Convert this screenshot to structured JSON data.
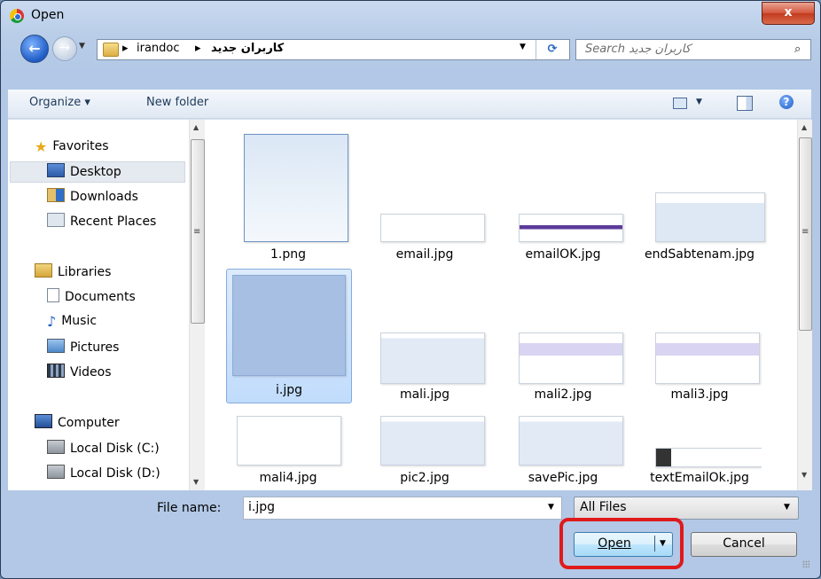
{
  "window": {
    "title": "Open",
    "close_glyph": "x"
  },
  "address": {
    "crumbs": [
      "irandoc",
      "کاربران جدید"
    ],
    "separator": "▸"
  },
  "search": {
    "placeholder": "Search کاربران جدید"
  },
  "toolbar": {
    "organize_label": "Organize ▾",
    "new_folder_label": "New folder"
  },
  "nav": {
    "favorites_label": "Favorites",
    "favorites": [
      "Desktop",
      "Downloads",
      "Recent Places"
    ],
    "selected": "Desktop",
    "libraries_label": "Libraries",
    "libraries": [
      "Documents",
      "Music",
      "Pictures",
      "Videos"
    ],
    "computer_label": "Computer",
    "computer": [
      "Local Disk (C:)",
      "Local Disk (D:)"
    ]
  },
  "files": [
    {
      "name": "1.png"
    },
    {
      "name": "email.jpg"
    },
    {
      "name": "emailOK.jpg"
    },
    {
      "name": "endSabtenam.jpg"
    },
    {
      "name": "i.jpg",
      "selected": true
    },
    {
      "name": "mali.jpg"
    },
    {
      "name": "mali2.jpg"
    },
    {
      "name": "mali3.jpg"
    },
    {
      "name": "mali4.jpg"
    },
    {
      "name": "pic2.jpg"
    },
    {
      "name": "savePic.jpg"
    },
    {
      "name": "textEmailOk.jpg"
    }
  ],
  "bottom": {
    "filename_label": "File name:",
    "filename_value": "i.jpg",
    "filter_value": "All Files",
    "open_label": "Open",
    "cancel_label": "Cancel"
  },
  "colors": {
    "highlight": "#e0191b",
    "selection": "#c1dcfc",
    "accent": "#1e5bc4"
  }
}
